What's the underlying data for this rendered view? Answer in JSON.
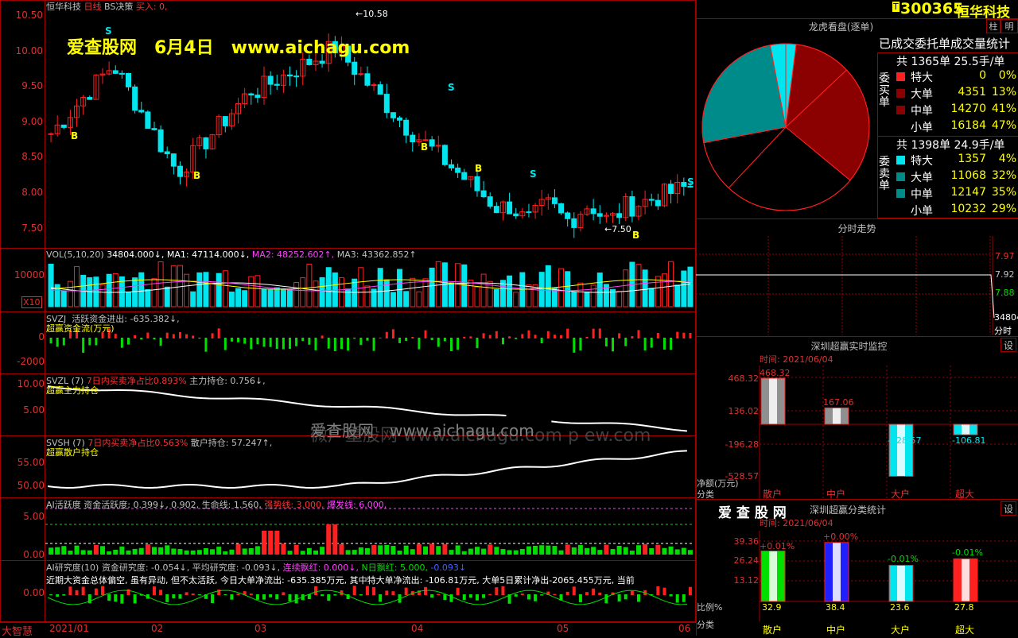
{
  "colors": {
    "bg": "#000000",
    "grid": "#a00000",
    "up": "#ff2020",
    "down": "#00e5ee",
    "green": "#00e000",
    "yellow": "#ffff00",
    "white": "#ffffff",
    "magenta": "#ff40ff"
  },
  "main": {
    "title": "恒华科技",
    "mode": "日线",
    "strategy": "BS决策",
    "buy_label": "买入: 0,",
    "watermark": "爱查股网　6月4日　www.aichagu.com",
    "high_mark": "←10.58",
    "low_mark": "←7.50",
    "y_labels": [
      "10.50",
      "10.00",
      "9.50",
      "9.00",
      "8.50",
      "8.00",
      "7.50"
    ],
    "b_marks": [
      "B",
      "B",
      "B",
      "B",
      "B"
    ],
    "s_marks": [
      "S",
      "S",
      "S",
      "S"
    ]
  },
  "vol": {
    "label": "VOL(5,10,20)",
    "value": "34804.000↓,",
    "ma1": "MA1: 47114.000↓,",
    "ma2": "MA2: 48252.602↑,",
    "ma3": "MA3: 43362.852↑",
    "y_labels": [
      "10000"
    ],
    "unit": "X10"
  },
  "svzj": {
    "label": "SVZJ",
    "desc": "活跃资金进出: -635.382↓,",
    "sub": "超赢资金流(万元)",
    "y_labels": [
      "0",
      "-2000"
    ]
  },
  "svzl": {
    "label": "SVZL (7)",
    "desc": "7日内买卖净占比0.893%",
    "desc2": "主力持仓: 0.756↓,",
    "sub": "超赢主力持仓",
    "y_labels": [
      "10.00",
      "5.00"
    ],
    "watermark": "爱查股网　www.aichagu.com",
    "watermark2": "微广重股网  www.aichagu.com  p  ew.com"
  },
  "svsh": {
    "label": "SVSH (7)",
    "desc": "7日内买卖净占比0.563%",
    "desc2": "散户持仓: 57.247↑,",
    "sub": "超赢散户持仓",
    "y_labels": [
      "55.00",
      "50.00"
    ]
  },
  "ai": {
    "label": "AI活跃度",
    "desc": "资金活跃度: 0.399↓, 0.902, 生命线: 1.560,",
    "strong": "强势线: 3.000,",
    "burst": "爆发线: 6.000,",
    "y_labels": [
      "5.00",
      "0.00"
    ]
  },
  "air": {
    "label": "AI研究度(10)",
    "desc": "资金研究度: -0.054↓, 平均研究度: -0.093↓,",
    "green_red": "连续飘红: 0.000↓,",
    "n_red": "N日飘红: 5.000,",
    "tail": "-0.093↓",
    "note": "近期大资金总体偏空, 虽有异动, 但不太活跃, 今日大单净流出: -635.385万元, 其中特大单净流出: -106.81万元, 大单5日累计净出-2065.455万元, 当前",
    "y_labels": [
      "0.00"
    ]
  },
  "footer": {
    "app": "大智慧",
    "dates": [
      "2021/01",
      "02",
      "03",
      "04",
      "05",
      "06"
    ]
  },
  "right": {
    "code": "300365",
    "name": "恒华科技",
    "badge": "T",
    "tab": "柱",
    "tab2": "明",
    "dragon_title": "龙虎看盘(逐单)",
    "stat_title": "已成交委托单成交量统计",
    "buy": {
      "side": "委买单",
      "total": "共 1365单 25.5手/单",
      "rows": [
        {
          "k": "特大",
          "v": "0",
          "p": "0%"
        },
        {
          "k": "大单",
          "v": "4351",
          "p": "13%"
        },
        {
          "k": "中单",
          "v": "14270",
          "p": "41%"
        },
        {
          "k": "小单",
          "v": "16184",
          "p": "47%"
        }
      ]
    },
    "sell": {
      "side": "委卖单",
      "total": "共 1398单 24.9手/单",
      "rows": [
        {
          "k": "特大",
          "v": "1357",
          "p": "4%"
        },
        {
          "k": "大单",
          "v": "11068",
          "p": "32%"
        },
        {
          "k": "中单",
          "v": "12147",
          "p": "35%"
        },
        {
          "k": "小单",
          "v": "10232",
          "p": "29%"
        }
      ]
    },
    "intraday_title": "分时走势",
    "intraday_labels": [
      "7.97",
      "7.92",
      "7.88",
      "34804",
      "分时"
    ],
    "monitor_title": "深圳超赢实时监控",
    "settings": "设",
    "monitor_time": "时间: 2021/06/04",
    "monitor_y": [
      "468.32",
      "136.02",
      "-196.28",
      "-528.57"
    ],
    "monitor_vals": [
      "468.32",
      "167.06",
      "-528.57",
      "-106.81"
    ],
    "monitor_cats": [
      "散户",
      "中户",
      "大户",
      "超大"
    ],
    "monitor_unit": "净额(万元)",
    "monitor_cat_label": "分类",
    "class_title": "深圳超赢分类统计",
    "class_brand": "爱 查 股 网",
    "class_time": "时间: 2021/06/04",
    "class_y": [
      "39.36",
      "26.24",
      "13.12"
    ],
    "class_top": [
      "+0.01%",
      "+0.00%",
      "-0.01%",
      "-0.01%"
    ],
    "class_bottom": [
      "32.9",
      "38.4",
      "23.6",
      "27.8"
    ],
    "class_cats": [
      "散户",
      "中户",
      "大户",
      "超大"
    ],
    "class_ratio": "比例%",
    "class_cat_label": "分类"
  }
}
